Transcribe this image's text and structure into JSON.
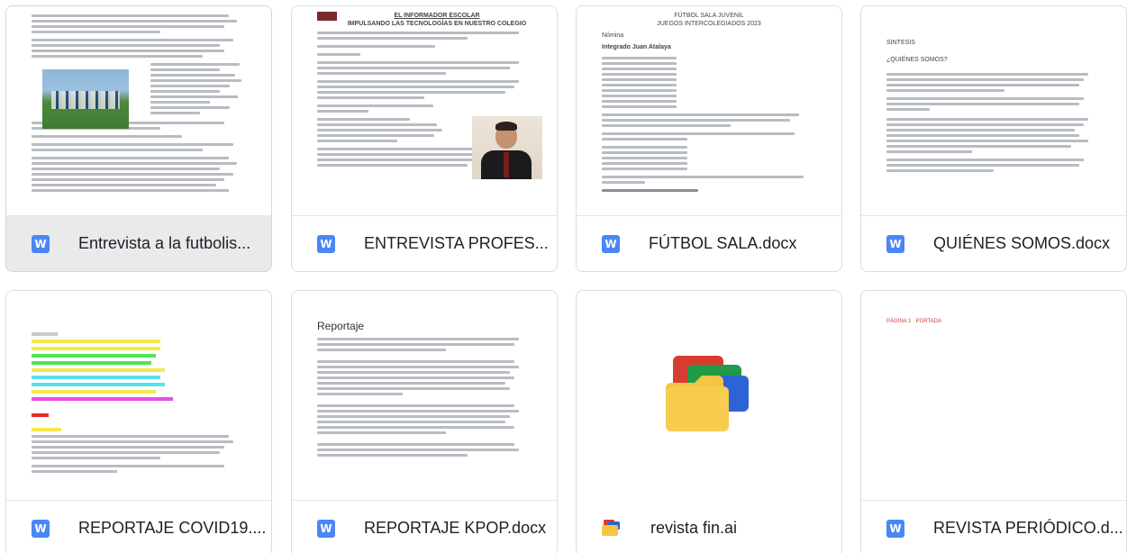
{
  "files": [
    {
      "name": "Entrevista a la futbolis...",
      "type": "word",
      "icon": "word-icon",
      "selected": true,
      "preview": {}
    },
    {
      "name": "ENTREVISTA PROFES...",
      "type": "word",
      "icon": "word-icon",
      "preview": {
        "header_title": "EL INFORMADOR ESCOLAR",
        "header_subtitle": "IMPULSANDO LAS TECNOLOGÍAS EN NUESTRO COLEGIO"
      }
    },
    {
      "name": "FÚTBOL SALA.docx",
      "type": "word",
      "icon": "word-icon",
      "preview": {
        "title": "FÚTBOL SALA JUVENIL",
        "subtitle": "JUEGOS INTERCOLEGIADOS 2023",
        "section": "Nómina",
        "team": "Integrado Juan Atalaya"
      }
    },
    {
      "name": "QUIÉNES SOMOS.docx",
      "type": "word",
      "icon": "word-icon",
      "preview": {
        "heading1": "SINTESIS",
        "heading2": "¿QUIÉNES SOMOS?"
      }
    },
    {
      "name": "REPORTAJE COVID19....",
      "type": "word",
      "icon": "word-icon",
      "preview": {}
    },
    {
      "name": "REPORTAJE KPOP.docx",
      "type": "word",
      "icon": "word-icon",
      "preview": {
        "title": "Reportaje"
      }
    },
    {
      "name": "revista fin.ai",
      "type": "folder",
      "icon": "colorful-folder-icon",
      "preview": {}
    },
    {
      "name": "REVISTA PERIÓDICO.d...",
      "type": "word",
      "icon": "word-icon",
      "preview": {
        "label": "PÁGINA 1 · PORTADA"
      }
    }
  ],
  "word_glyph": "W",
  "colors": {
    "word_blue": "#4a86f6",
    "selected_bg": "#e9eaec",
    "border": "#dadce0",
    "folder_red": "#d83b2f",
    "folder_green": "#1f9c45",
    "folder_blue": "#2d63d6",
    "folder_yellow": "#f5c542"
  }
}
